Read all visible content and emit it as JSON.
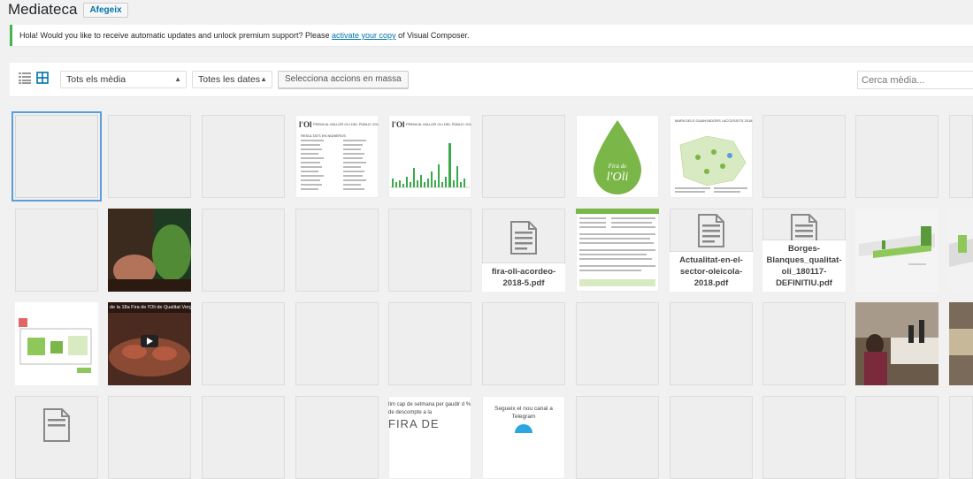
{
  "header": {
    "title": "Mediateca",
    "add_new_label": "Afegeix"
  },
  "notice": {
    "text_before": "Hola! Would you like to receive automatic updates and unlock premium support? Please ",
    "link_text": "activate your copy",
    "text_after": " of Visual Composer."
  },
  "toolbar": {
    "filter_type": "Tots els mèdia",
    "filter_date": "Totes les dates",
    "bulk_select_label": "Selecciona accions en massa",
    "search_placeholder": "Cerca mèdia..."
  },
  "colors": {
    "accent": "#0073aa",
    "notice_border": "#46b450",
    "selected_outline": "#5b9dd9",
    "oil_green": "#7ab648"
  },
  "media": {
    "t4_title": "PREMI AL MILLOR OLI DEL PÚBLIC 2018",
    "t4_subtitle": "RESULTATS EN NÚMEROS",
    "t5_title": "PREMI AL MILLOR OLI DEL PÚBLIC 2018",
    "t7_logo": "Fira de l'Oli",
    "t8_title": "MAPA DELS GUANYADORS I ACCESSITS 2018",
    "f1": "fira-oli-acordeo-2018-5.pdf",
    "f2": "Actualitat-en-el-sector-oleicola-2018.pdf",
    "f3": "Borges-Blanques_qualitat-oli_180117-DEFINITIU.pdf",
    "video_caption": "de la 18a Fira de l'Oli de Qualitat Verge",
    "promo_text": "tim cap de setmana per gaudir d % de descompte a la",
    "promo_big": "FIRA DE",
    "telegram_text": "Segueix el nou canal a Telegram"
  }
}
